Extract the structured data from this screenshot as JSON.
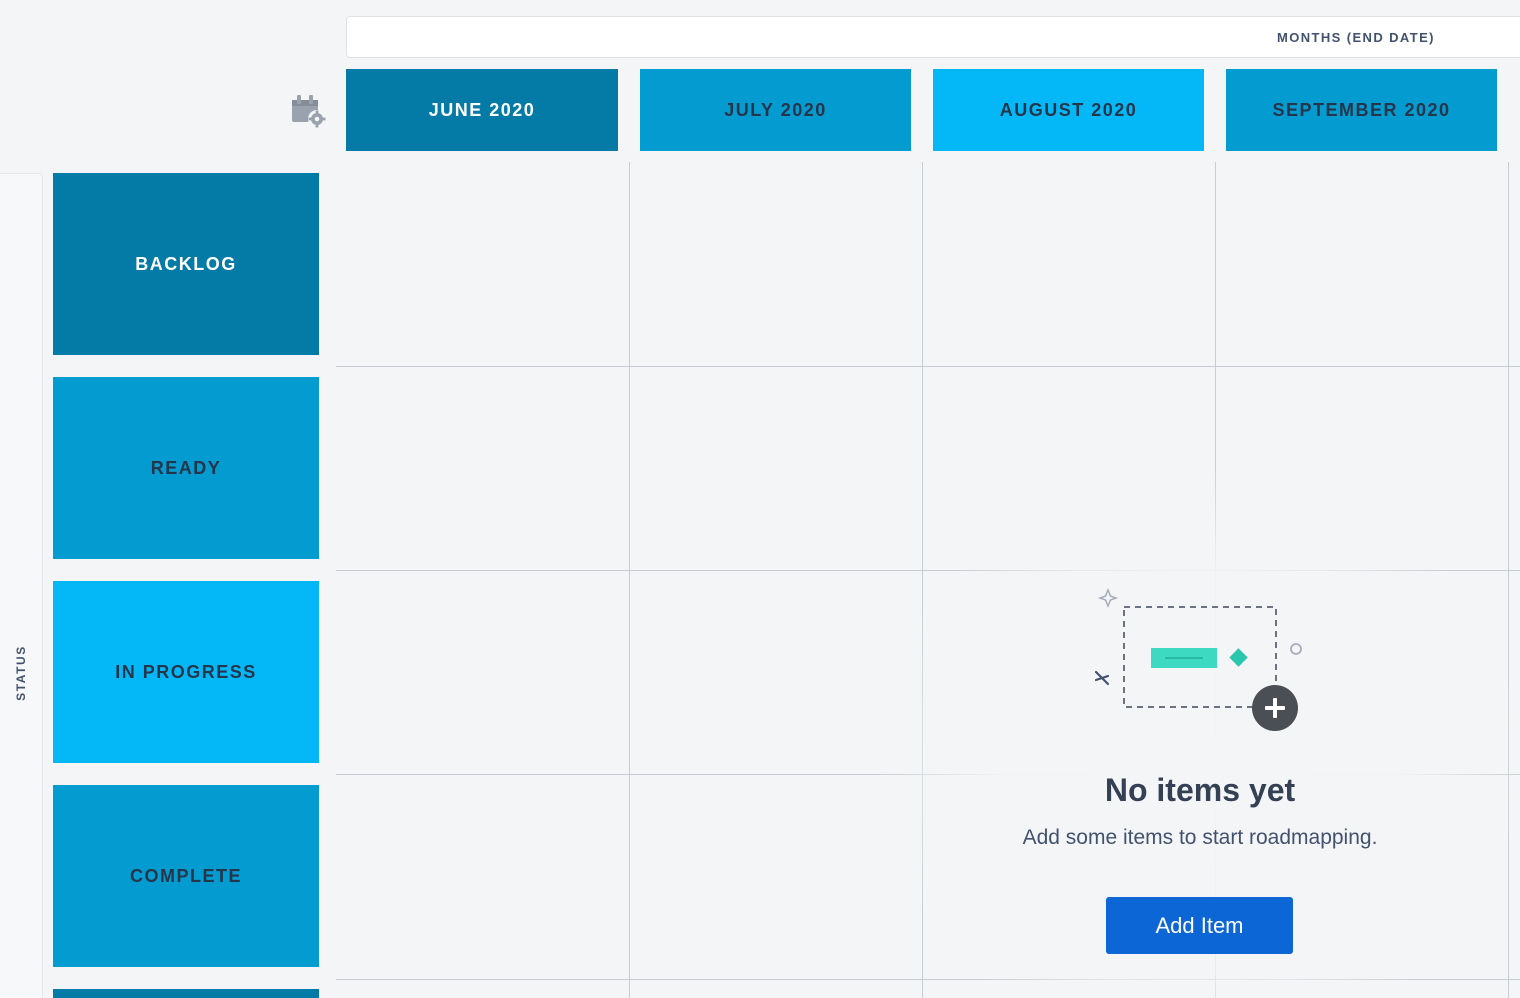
{
  "axis_bar": {
    "label": "MONTHS (END DATE)"
  },
  "columns": [
    {
      "label": "JUNE 2020",
      "bg": "#037ba6",
      "fg": "#ffffff"
    },
    {
      "label": "JULY 2020",
      "bg": "#049bd0",
      "fg": "#25354a"
    },
    {
      "label": "AUGUST 2020",
      "bg": "#04b8f8",
      "fg": "#25354a"
    },
    {
      "label": "SEPTEMBER 2020",
      "bg": "#049bd0",
      "fg": "#25354a"
    }
  ],
  "status_strip": {
    "label": "STATUS"
  },
  "rows": [
    {
      "label": "BACKLOG",
      "bg": "#037ba6",
      "fg": "#ffffff"
    },
    {
      "label": "READY",
      "bg": "#049bd0",
      "fg": "#25354a"
    },
    {
      "label": "IN PROGRESS",
      "bg": "#04b8f8",
      "fg": "#25354a"
    },
    {
      "label": "COMPLETE",
      "bg": "#049bd0",
      "fg": "#25354a"
    },
    {
      "label": "",
      "bg": "#037ba6",
      "fg": "#ffffff"
    }
  ],
  "empty_state": {
    "title": "No items yet",
    "description": "Add some items to start roadmapping.",
    "button_label": "Add Item",
    "button_color": "#0c66d6",
    "illustration_accent": "#3dd9c1"
  },
  "icons": {
    "settings": "calendar-gear-icon",
    "illustration": "empty-roadmap-illustration"
  }
}
